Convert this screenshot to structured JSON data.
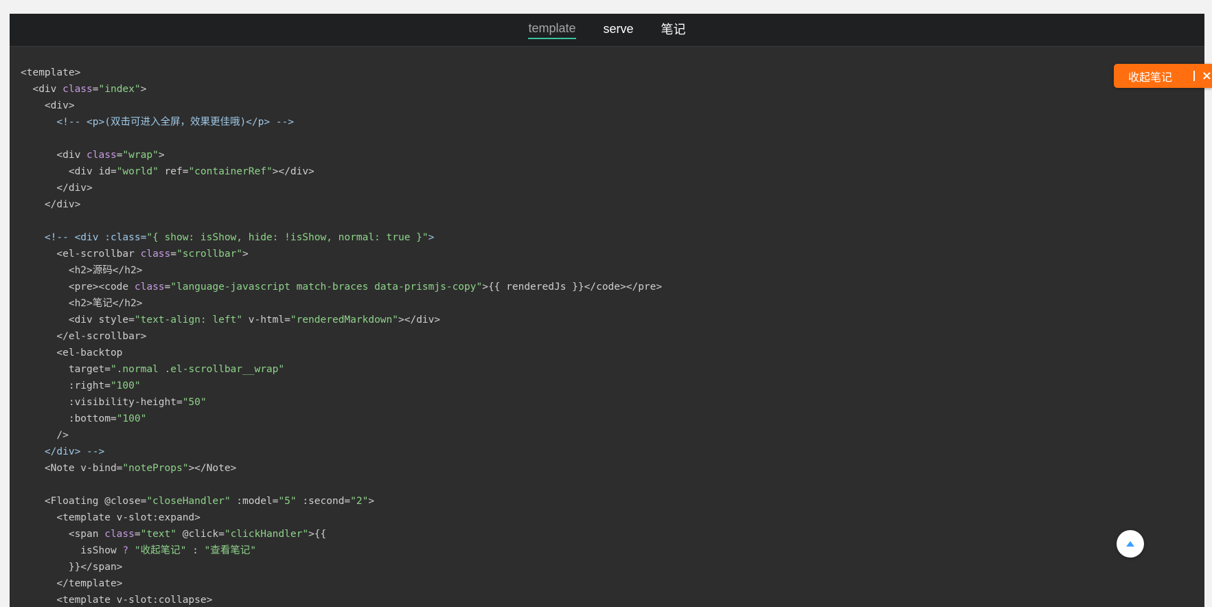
{
  "tabs": [
    {
      "label": "template",
      "active": true
    },
    {
      "label": "serve",
      "active": false
    },
    {
      "label": "笔记",
      "active": false
    }
  ],
  "floating_button": {
    "label": "收起笔记",
    "close_glyph": "×",
    "color": "#ff6f0f"
  },
  "backtop_icon": "chevron-up-icon",
  "code_lines": [
    "<template>",
    "  <div class=\"index\">",
    "    <div>",
    "      <!-- <p>(双击可进入全屏，效果更佳哦)</p> -->",
    "",
    "      <div class=\"wrap\">",
    "        <div id=\"world\" ref=\"containerRef\"></div>",
    "      </div>",
    "    </div>",
    "",
    "    <!-- <div :class=\"{ show: isShow, hide: !isShow, normal: true }\">",
    "      <el-scrollbar class=\"scrollbar\">",
    "        <h2>源码</h2>",
    "        <pre><code class=\"language-javascript match-braces data-prismjs-copy\">{{ renderedJs }}</code></pre>",
    "        <h2>笔记</h2>",
    "        <div style=\"text-align: left\" v-html=\"renderedMarkdown\"></div>",
    "      </el-scrollbar>",
    "      <el-backtop",
    "        target=\".normal .el-scrollbar__wrap\"",
    "        :right=\"100\"",
    "        :visibility-height=\"50\"",
    "        :bottom=\"100\"",
    "      />",
    "    </div> -->",
    "    <Note v-bind=\"noteProps\"></Note>",
    "",
    "    <Floating @close=\"closeHandler\" :model=\"5\" :second=\"2\">",
    "      <template v-slot:expand>",
    "        <span class=\"text\" @click=\"clickHandler\">{{",
    "          isShow ? \"收起笔记\" : \"查看笔记\"",
    "        }}</span>",
    "      </template>",
    "      <template v-slot:collapse>"
  ]
}
